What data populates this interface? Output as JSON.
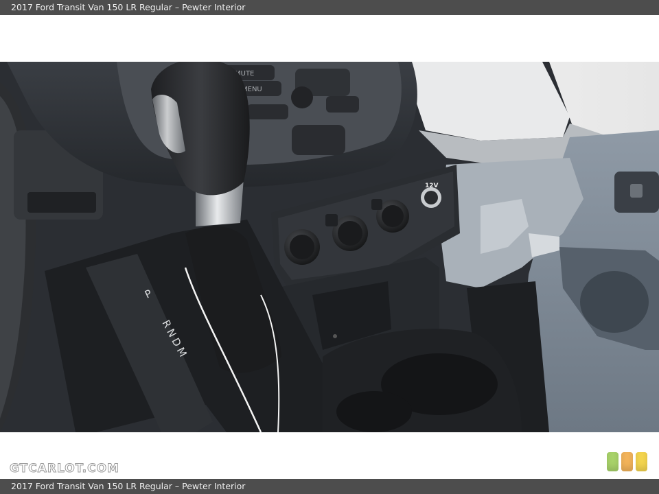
{
  "header": {
    "title": "2017 Ford Transit Van 150 LR Regular – Pewter Interior"
  },
  "footer": {
    "caption": "2017 Ford Transit Van 150 LR Regular – Pewter Interior"
  },
  "photo": {
    "subject": "gear-shifter-and-center-console",
    "labels": {
      "shift_p": "P",
      "shift_rndm": "RNDM",
      "outlet": "12V",
      "mute": "MUTE",
      "menu": "MENU"
    }
  },
  "watermark": {
    "site": "GTCARLOT.COM"
  },
  "colors": {
    "green": "#a8d26a",
    "orange": "#f2b35a",
    "yellow": "#f3d44e"
  }
}
